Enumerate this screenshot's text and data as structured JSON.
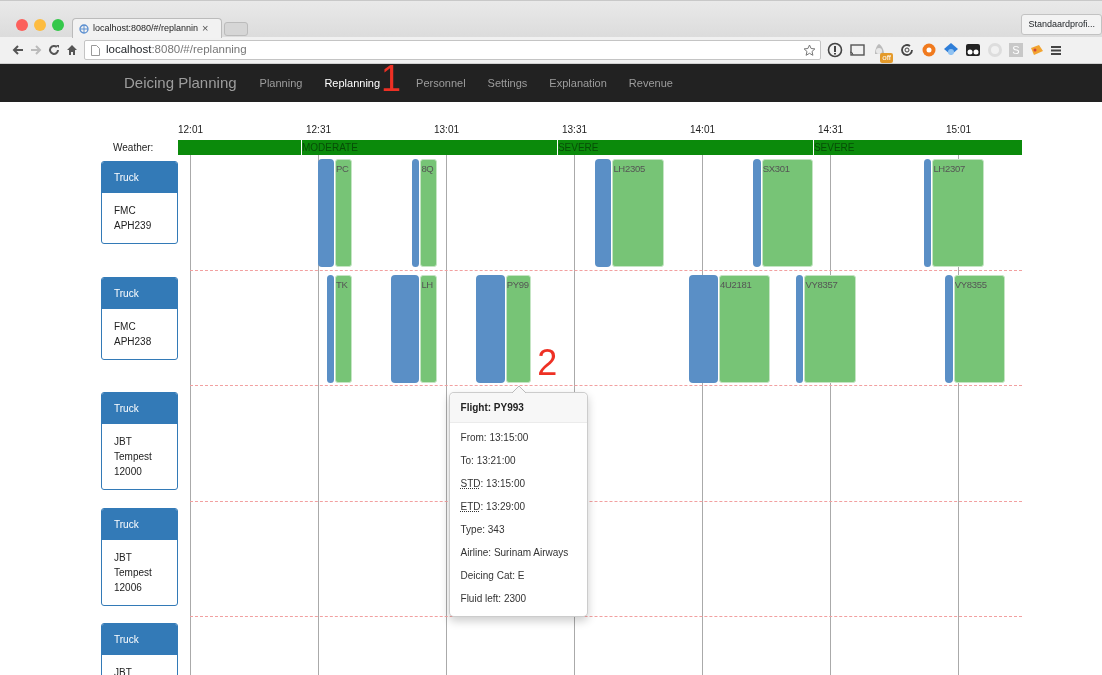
{
  "browser": {
    "tab_title": "localhost:8080/#/replannin",
    "tab_close": "×",
    "url_host": "localhost",
    "url_rest": ":8080/#/replanning",
    "profile": "Standaardprofi...",
    "extension_badge": "off",
    "extension_letter": "S"
  },
  "navbar": {
    "brand": "Deicing Planning",
    "items": [
      {
        "label": "Planning",
        "selected": false
      },
      {
        "label": "Replanning",
        "selected": true,
        "marker": "1"
      },
      {
        "label": "Personnel",
        "selected": false
      },
      {
        "label": "Settings",
        "selected": false
      },
      {
        "label": "Explanation",
        "selected": false
      },
      {
        "label": "Revenue",
        "selected": false
      }
    ]
  },
  "timeline": {
    "weather_label": "Weather:",
    "ticks": [
      "12:01",
      "12:31",
      "13:01",
      "13:31",
      "14:01",
      "14:31",
      "15:01"
    ],
    "weather": [
      {
        "label": "MODERATE"
      },
      {
        "label": "SEVERE"
      },
      {
        "label": "SEVERE"
      }
    ],
    "trucks": [
      {
        "type": "Truck",
        "name_lines": [
          "FMC",
          "APH239"
        ],
        "jobs": [
          {
            "flight": "PC"
          },
          {
            "flight": "8Q"
          },
          {
            "flight": "LH2305"
          },
          {
            "flight": "SX301"
          },
          {
            "flight": "LH2307"
          }
        ]
      },
      {
        "type": "Truck",
        "name_lines": [
          "FMC",
          "APH238"
        ],
        "jobs": [
          {
            "flight": "TK"
          },
          {
            "flight": "LH"
          },
          {
            "flight": "PY99",
            "marker": "2",
            "popover": {
              "title": "Flight: PY993",
              "lines": [
                {
                  "text": "From: 13:15:00"
                },
                {
                  "text": "To: 13:21:00"
                },
                {
                  "abbr": "STD",
                  "text": ": 13:15:00"
                },
                {
                  "abbr": "ETD",
                  "text": ": 13:29:00"
                },
                {
                  "text": "Type: 343"
                },
                {
                  "text": "Airline: Surinam Airways"
                },
                {
                  "text": "Deicing Cat: E"
                },
                {
                  "text": "Fluid left: 2300"
                }
              ]
            }
          },
          {
            "flight": "4U2181"
          },
          {
            "flight": "VY8357"
          },
          {
            "flight": "VY8355"
          }
        ]
      },
      {
        "type": "Truck",
        "name_lines": [
          "JBT",
          "Tempest",
          "12000"
        ]
      },
      {
        "type": "Truck",
        "name_lines": [
          "JBT",
          "Tempest",
          "12006"
        ]
      },
      {
        "type": "Truck",
        "name_lines": [
          "JBT"
        ]
      }
    ]
  }
}
